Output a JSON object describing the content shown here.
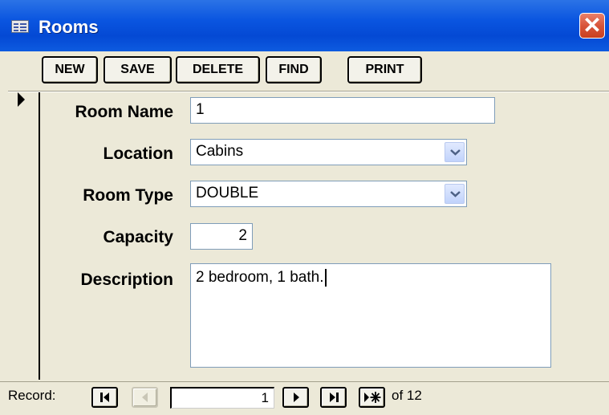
{
  "window": {
    "title": "Rooms",
    "icon": "form-icon",
    "close": "close-icon"
  },
  "toolbar": {
    "new_label": "NEW",
    "save_label": "SAVE",
    "delete_label": "DELETE",
    "find_label": "FIND",
    "print_label": "PRINT"
  },
  "form": {
    "room_name_label": "Room Name",
    "room_name_value": "1",
    "location_label": "Location",
    "location_value": "Cabins",
    "room_type_label": "Room Type",
    "room_type_value": "DOUBLE",
    "capacity_label": "Capacity",
    "capacity_value": "2",
    "description_label": "Description",
    "description_value": "2 bedroom, 1 bath."
  },
  "navigation": {
    "record_label": "Record:",
    "current_record": "1",
    "total_text": "of  12"
  },
  "colors": {
    "titlebar": "#0A55E0",
    "face": "#ECE9D8",
    "close": "#D8553A"
  }
}
